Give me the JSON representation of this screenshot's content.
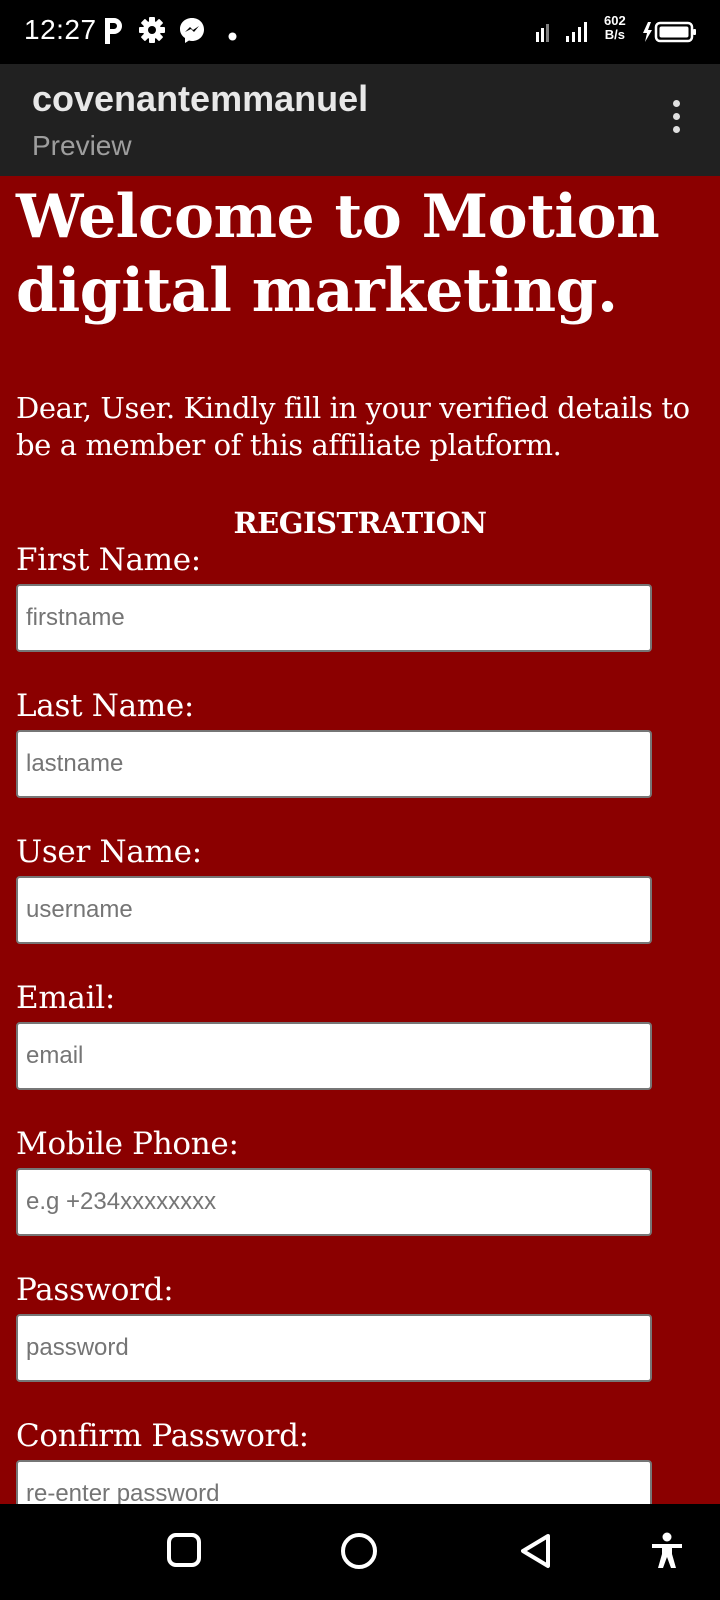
{
  "status_bar": {
    "time": "12:27",
    "net_speed_value": "602",
    "net_speed_unit": "B/s",
    "icons": [
      "pinterest-icon",
      "gear-icon",
      "messenger-icon",
      "notification-dot-icon",
      "signal-icon",
      "battery-charging-icon"
    ]
  },
  "app_bar": {
    "title": "covenantemmanuel",
    "subtitle": "Preview"
  },
  "page": {
    "heading": "Welcome to Motion digital marketing.",
    "intro": "Dear, User. Kindly fill in your verified details to be a member of this affiliate platform.",
    "section_title": "REGISTRATION",
    "fields": [
      {
        "label": "First Name:",
        "placeholder": "firstname"
      },
      {
        "label": "Last Name:",
        "placeholder": "lastname"
      },
      {
        "label": "User Name:",
        "placeholder": "username"
      },
      {
        "label": "Email:",
        "placeholder": "email"
      },
      {
        "label": "Mobile Phone:",
        "placeholder": "e.g +234xxxxxxxx"
      },
      {
        "label": "Password:",
        "placeholder": "password"
      },
      {
        "label": "Confirm Password:",
        "placeholder": "re-enter password"
      }
    ]
  },
  "nav_bar": {
    "buttons": [
      "recents-button",
      "home-button",
      "back-button",
      "accessibility-button"
    ]
  },
  "colors": {
    "page_background": "#8b0000",
    "app_bar": "#212121",
    "status_bar": "#000000"
  }
}
